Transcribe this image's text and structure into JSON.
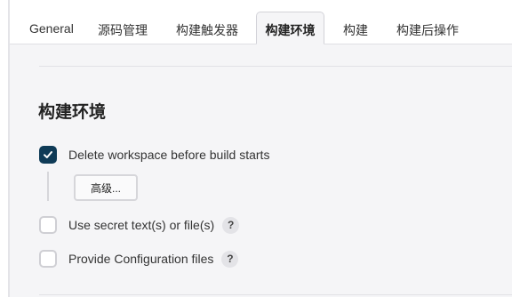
{
  "tabs": [
    {
      "label": "General",
      "active": false
    },
    {
      "label": "源码管理",
      "active": false
    },
    {
      "label": "构建触发器",
      "active": false
    },
    {
      "label": "构建环境",
      "active": true
    },
    {
      "label": "构建",
      "active": false
    },
    {
      "label": "构建后操作",
      "active": false
    }
  ],
  "section": {
    "title": "构建环境",
    "options": [
      {
        "label": "Delete workspace before build starts",
        "checked": true,
        "has_help": false
      },
      {
        "label": "Use secret text(s) or file(s)",
        "checked": false,
        "has_help": true
      },
      {
        "label": "Provide Configuration files",
        "checked": false,
        "has_help": true
      }
    ],
    "advanced_button": "高级...",
    "help_glyph": "?"
  },
  "colors": {
    "accent": "#0f3b57",
    "panel_bg": "#f5f5f7",
    "border": "#d6d6da"
  },
  "icons": {
    "checkmark": "check-icon",
    "help": "question-mark-icon"
  }
}
